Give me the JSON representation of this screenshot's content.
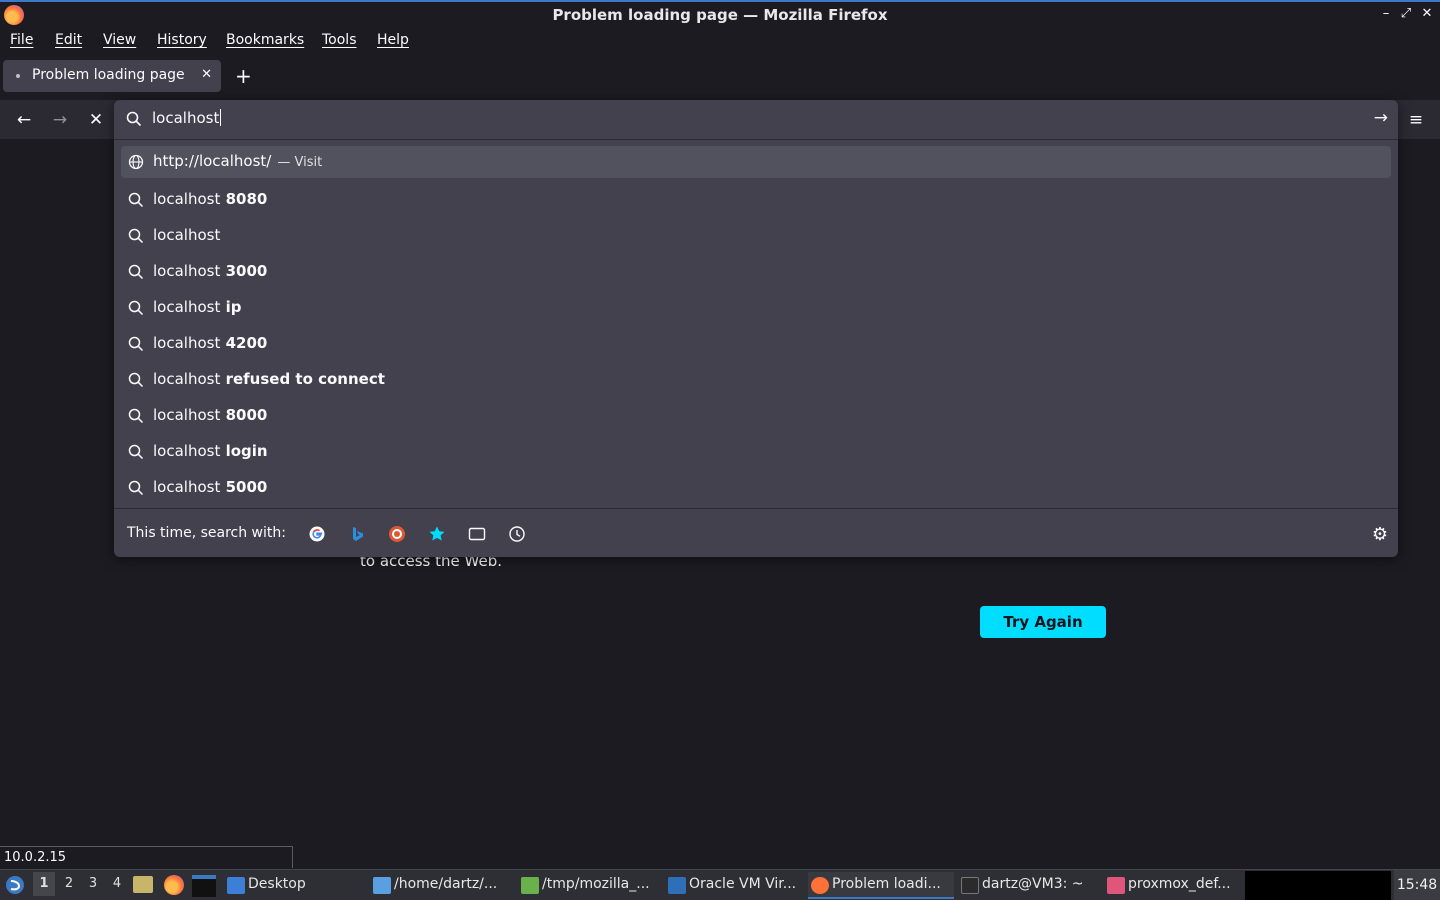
{
  "window": {
    "title": "Problem loading page — Mozilla Firefox",
    "controls": [
      "–",
      "⤢",
      "✕"
    ]
  },
  "menu": [
    "File",
    "Edit",
    "View",
    "History",
    "Bookmarks",
    "Tools",
    "Help"
  ],
  "tab": {
    "label": "Problem loading page",
    "close": "✕",
    "new_tab": "+"
  },
  "nav": {
    "back": "←",
    "forward": "→",
    "stop": "✕",
    "menu": "≡"
  },
  "urlbar": {
    "value": "localhost",
    "go": "→",
    "visit_row": {
      "url": "http://localhost/",
      "separator": "—",
      "action": "Visit"
    },
    "suggestions": [
      {
        "typed": "localhost",
        "completion": " 8080"
      },
      {
        "typed": "localhost",
        "completion": ""
      },
      {
        "typed": "localhost",
        "completion": " 3000"
      },
      {
        "typed": "localhost",
        "completion": " ip"
      },
      {
        "typed": "localhost",
        "completion": " 4200"
      },
      {
        "typed": "localhost",
        "completion": " refused to connect"
      },
      {
        "typed": "localhost",
        "completion": " 8000"
      },
      {
        "typed": "localhost",
        "completion": " login"
      },
      {
        "typed": "localhost",
        "completion": " 5000"
      }
    ],
    "oneoff_label": "This time, search with:",
    "engines": [
      "google-icon",
      "bing-icon",
      "duckduckgo-icon",
      "bookmarks-icon",
      "tabs-icon",
      "history-icon"
    ]
  },
  "page": {
    "partial_text": "to access the Web.",
    "try_again": "Try Again"
  },
  "status": "10.0.2.15",
  "taskbar": {
    "workspaces": [
      "1",
      "2",
      "3",
      "4"
    ],
    "tasks": [
      {
        "label": "Desktop",
        "color": "#3d7fd6"
      },
      {
        "label": "/home/dartz/...",
        "color": "#5aa0e0"
      },
      {
        "label": "/tmp/mozilla_...",
        "color": "#6ab04c"
      },
      {
        "label": "Oracle VM Vir...",
        "color": "#2f6fb8"
      },
      {
        "label": "Problem loadi...",
        "color": "#ff7139"
      },
      {
        "label": "dartz@VM3: ~",
        "color": "#2b2b2b"
      },
      {
        "label": "proxmox_def...",
        "color": "#e0567a"
      }
    ],
    "clock": "15:48"
  }
}
